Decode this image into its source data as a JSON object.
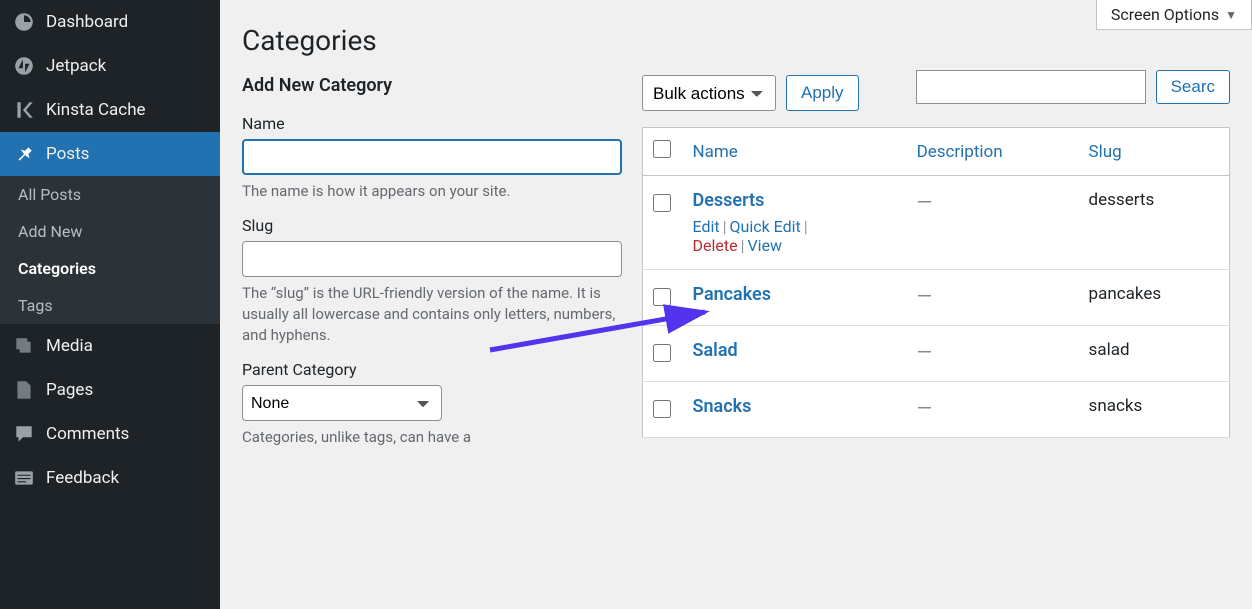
{
  "screen_options_label": "Screen Options",
  "sidebar": {
    "items": [
      {
        "label": "Dashboard"
      },
      {
        "label": "Jetpack"
      },
      {
        "label": "Kinsta Cache"
      },
      {
        "label": "Posts"
      },
      {
        "label": "Media"
      },
      {
        "label": "Pages"
      },
      {
        "label": "Comments"
      },
      {
        "label": "Feedback"
      }
    ],
    "posts_sub": [
      {
        "label": "All Posts"
      },
      {
        "label": "Add New"
      },
      {
        "label": "Categories"
      },
      {
        "label": "Tags"
      }
    ]
  },
  "page_title": "Categories",
  "search": {
    "button": "Searc"
  },
  "form": {
    "heading": "Add New Category",
    "name_label": "Name",
    "name_help": "The name is how it appears on your site.",
    "slug_label": "Slug",
    "slug_help": "The “slug” is the URL-friendly version of the name. It is usually all lowercase and contains only letters, numbers, and hyphens.",
    "parent_label": "Parent Category",
    "parent_value": "None",
    "parent_help": "Categories, unlike tags, can have a"
  },
  "bulk": {
    "label": "Bulk actions",
    "apply": "Apply"
  },
  "table": {
    "cols": {
      "name": "Name",
      "description": "Description",
      "slug": "Slug"
    },
    "rows": [
      {
        "name": "Desserts",
        "desc": "—",
        "slug": "desserts",
        "show_actions": true
      },
      {
        "name": "Pancakes",
        "desc": "—",
        "slug": "pancakes",
        "show_actions": false
      },
      {
        "name": "Salad",
        "desc": "—",
        "slug": "salad",
        "show_actions": false
      },
      {
        "name": "Snacks",
        "desc": "—",
        "slug": "snacks",
        "show_actions": false
      }
    ],
    "actions": {
      "edit": "Edit",
      "quick_edit": "Quick Edit",
      "delete": "Delete",
      "view": "View"
    }
  }
}
